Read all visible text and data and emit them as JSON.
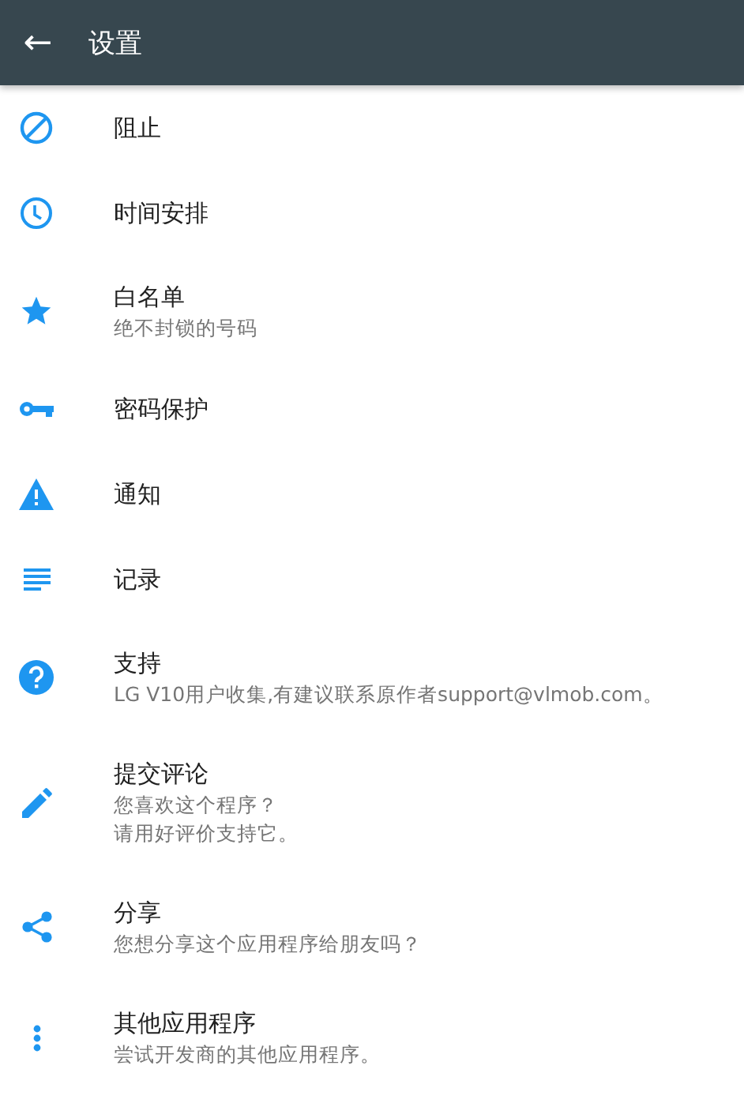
{
  "app_bar": {
    "back_icon": "←",
    "title": "设置"
  },
  "settings": [
    {
      "title": "阻止"
    },
    {
      "title": "时间安排"
    },
    {
      "title": "白名单",
      "subtitle": "绝不封锁的号码"
    },
    {
      "title": "密码保护"
    },
    {
      "title": "通知"
    },
    {
      "title": "记录"
    },
    {
      "title": "支持",
      "subtitle": "LG V10用户收集,有建议联系原作者support@vlmob.com。"
    },
    {
      "title": "提交评论",
      "subtitle_lines": [
        "您喜欢这个程序？",
        "请用好评价支持它。"
      ]
    },
    {
      "title": "分享",
      "subtitle": "您想分享这个应用程序给朋友吗？"
    },
    {
      "title": "其他应用程序",
      "subtitle": "尝试开发商的其他应用程序。"
    }
  ]
}
